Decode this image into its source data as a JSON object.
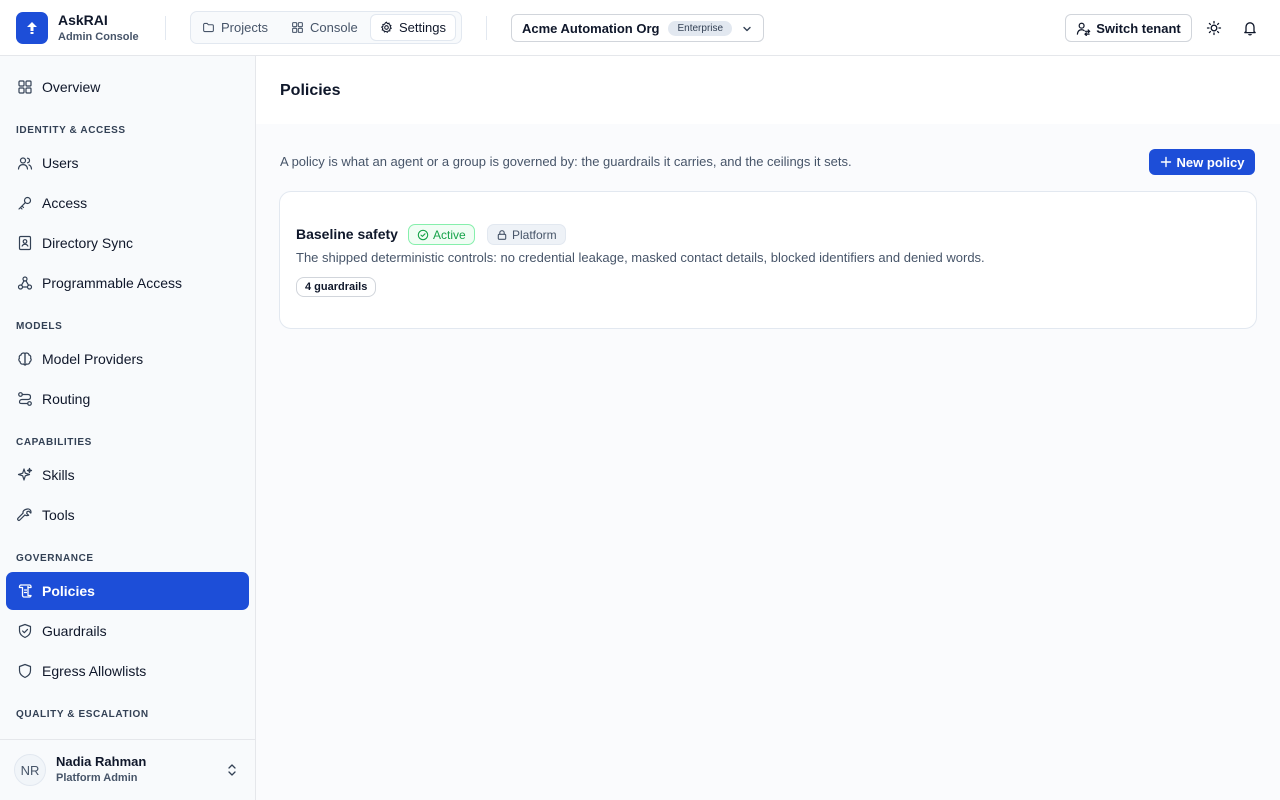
{
  "app": {
    "name": "AskRAI",
    "subtitle": "Admin Console"
  },
  "header": {
    "tabs": [
      {
        "label": "Projects",
        "icon": "folder-icon"
      },
      {
        "label": "Console",
        "icon": "grid-icon"
      },
      {
        "label": "Settings",
        "icon": "gear-icon",
        "active": true
      }
    ],
    "org": {
      "name": "Acme Automation Org",
      "plan": "Enterprise"
    },
    "switch_tenant": "Switch tenant"
  },
  "sidebar": {
    "overview": "Overview",
    "sections": {
      "identity": "IDENTITY & ACCESS",
      "models": "MODELS",
      "capabilities": "CAPABILITIES",
      "governance": "GOVERNANCE",
      "quality": "QUALITY & ESCALATION"
    },
    "items": {
      "users": "Users",
      "access": "Access",
      "directory_sync": "Directory Sync",
      "programmable_access": "Programmable Access",
      "model_providers": "Model Providers",
      "routing": "Routing",
      "skills": "Skills",
      "tools": "Tools",
      "policies": "Policies",
      "guardrails": "Guardrails",
      "egress_allowlists": "Egress Allowlists"
    },
    "active_item": "policies",
    "user": {
      "initials": "NR",
      "name": "Nadia Rahman",
      "role": "Platform Admin"
    }
  },
  "main": {
    "title": "Policies",
    "description": "A policy is what an agent or a group is governed by: the guardrails it carries, and the ceilings it sets.",
    "new_button": "New policy",
    "policies": [
      {
        "name": "Baseline safety",
        "status": "Active",
        "scope": "Platform",
        "description": "The shipped deterministic controls: no credential leakage, masked contact details, blocked identifiers and denied words.",
        "guardrail_count": "4 guardrails"
      }
    ]
  },
  "colors": {
    "accent": "#1d4ed8",
    "active_badge": "#16a34a",
    "sidebar_bg": "#f8fafc"
  }
}
